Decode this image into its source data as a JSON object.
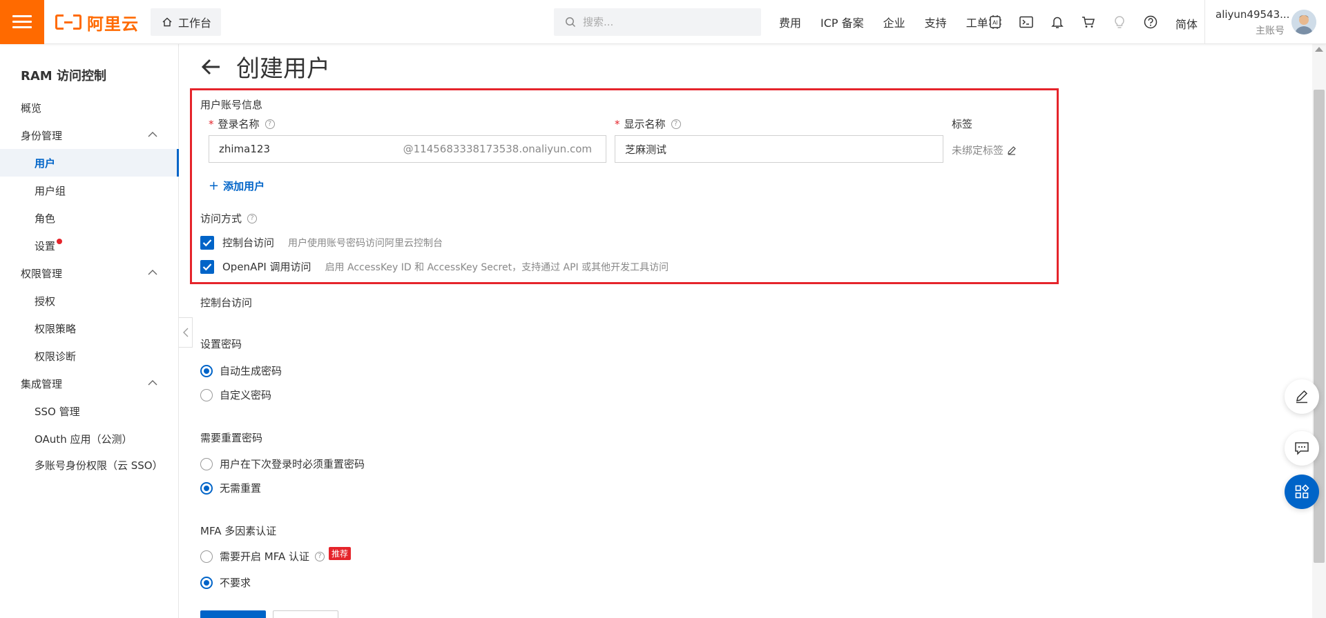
{
  "header": {
    "logo_text": "阿里云",
    "workbench_label": "工作台",
    "search_placeholder": "搜索...",
    "nav_links": [
      "费用",
      "ICP 备案",
      "企业",
      "支持",
      "工单"
    ],
    "language": "简体",
    "user_name": "aliyun49543...",
    "user_role": "主账号"
  },
  "sidebar": {
    "title": "RAM 访问控制",
    "items": [
      {
        "label": "概览",
        "level": 1
      },
      {
        "label": "身份管理",
        "level": 1,
        "group": true
      },
      {
        "label": "用户",
        "level": 2,
        "active": true
      },
      {
        "label": "用户组",
        "level": 2
      },
      {
        "label": "角色",
        "level": 2
      },
      {
        "label": "设置",
        "level": 2,
        "dot": true
      },
      {
        "label": "权限管理",
        "level": 1,
        "group": true
      },
      {
        "label": "授权",
        "level": 2
      },
      {
        "label": "权限策略",
        "level": 2
      },
      {
        "label": "权限诊断",
        "level": 2
      },
      {
        "label": "集成管理",
        "level": 1,
        "group": true
      },
      {
        "label": "SSO 管理",
        "level": 2
      },
      {
        "label": "OAuth 应用（公测）",
        "level": 2
      },
      {
        "label": "多账号身份权限（云 SSO）",
        "level": 2
      }
    ]
  },
  "form": {
    "page_title": "创建用户",
    "account_section": "用户账号信息",
    "login_name_label": "登录名称",
    "login_name_value": "zhima123",
    "login_name_suffix": "@1145683338173538.onaliyun.com",
    "display_name_label": "显示名称",
    "display_name_value": "芝麻测试",
    "tag_label": "标签",
    "tag_empty": "未绑定标签",
    "add_user": "添加用户",
    "access_section": "访问方式",
    "console_access_label": "控制台访问",
    "console_access_desc": "用户使用账号密码访问阿里云控制台",
    "api_access_label": "OpenAPI 调用访问",
    "api_access_desc": "启用 AccessKey ID 和 AccessKey Secret，支持通过 API 或其他开发工具访问",
    "console_section": "控制台访问",
    "password_section": "设置密码",
    "password_auto": "自动生成密码",
    "password_custom": "自定义密码",
    "reset_section": "需要重置密码",
    "reset_required": "用户在下次登录时必须重置密码",
    "reset_none": "无需重置",
    "mfa_section": "MFA 多因素认证",
    "mfa_required": "需要开启 MFA 认证",
    "mfa_badge": "推荐",
    "mfa_none": "不要求"
  },
  "colors": {
    "brand": "#ff6a00",
    "primary": "#0064c8",
    "highlight": "#e5242b"
  }
}
